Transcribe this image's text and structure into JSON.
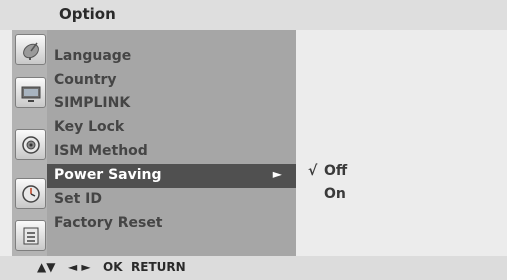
{
  "title": "Option",
  "menu": {
    "items": [
      {
        "label": "Language"
      },
      {
        "label": "Country"
      },
      {
        "label": "SIMPLINK"
      },
      {
        "label": "Key Lock"
      },
      {
        "label": "ISM Method"
      },
      {
        "label": "Power Saving",
        "selected": true,
        "arrow": "►"
      },
      {
        "label": "Set ID"
      },
      {
        "label": "Factory Reset"
      }
    ]
  },
  "options": {
    "items": [
      {
        "check": "√",
        "label": "Off",
        "checked": true
      },
      {
        "check": "",
        "label": "On",
        "checked": false
      }
    ]
  },
  "sidebar_icons": [
    "satellite-dish-icon",
    "tv-screen-icon",
    "speaker-icon",
    "clock-icon",
    "option-list-icon"
  ],
  "nav": {
    "move": "▲▼",
    "adjust": "◄ ►",
    "ok": "OK",
    "return": "RETURN"
  },
  "colors": {
    "selected_bg": "#505050",
    "menu_bg": "#a6a6a6",
    "rail_bg": "#b3b3b3"
  }
}
